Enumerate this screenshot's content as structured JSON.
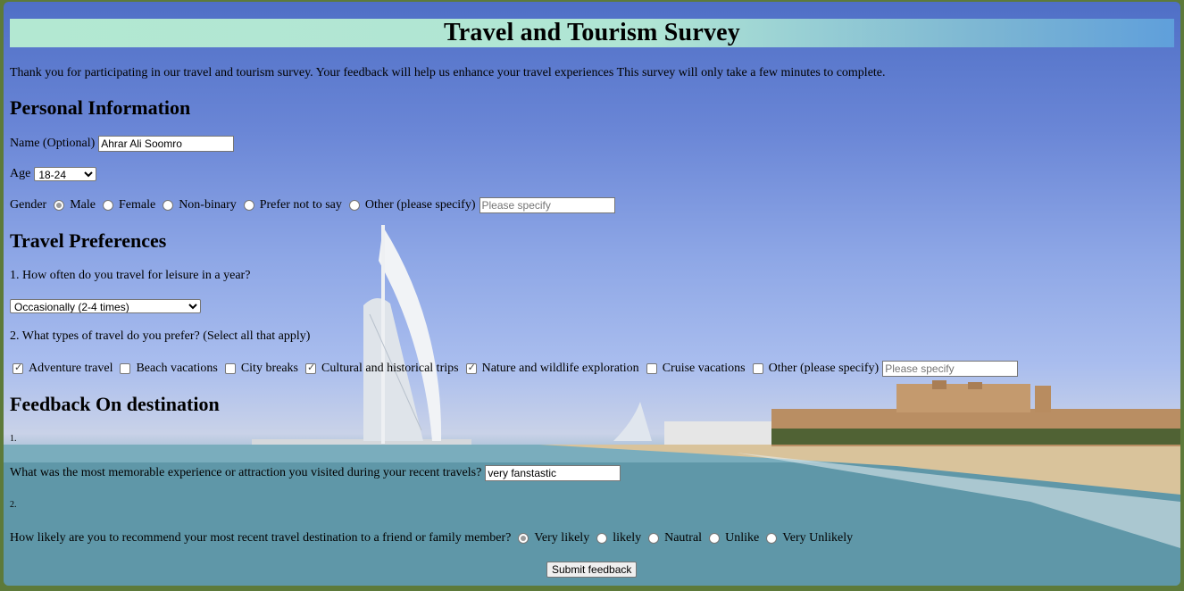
{
  "title": "Travel and Tourism Survey",
  "intro": "Thank you for participating in our travel and tourism survey. Your feedback will help us enhance your travel experiences This survey will only take a few minutes to complete.",
  "personal": {
    "heading": "Personal Information",
    "name_label": "Name (Optional)",
    "name_value": "Ahrar Ali Soomro",
    "age_label": "Age",
    "age_selected": "18-24",
    "gender_label": "Gender",
    "gender_options": [
      "Male",
      "Female",
      "Non-binary",
      "Prefer not to say",
      "Other (please specify)"
    ],
    "gender_selected": "Male",
    "gender_other_placeholder": "Please specify"
  },
  "preferences": {
    "heading": "Travel Preferences",
    "q1": "1. How often do you travel for leisure in a year?",
    "q1_selected": "Occasionally (2-4 times)",
    "q2": "2. What types of travel do you prefer? (Select all that apply)",
    "travel_types": [
      {
        "label": "Adventure travel",
        "checked": true
      },
      {
        "label": "Beach vacations",
        "checked": false
      },
      {
        "label": "City breaks",
        "checked": false
      },
      {
        "label": "Cultural and historical trips",
        "checked": true
      },
      {
        "label": "Nature and wildlife exploration",
        "checked": true
      },
      {
        "label": "Cruise vacations",
        "checked": false
      },
      {
        "label": "Other (please specify)",
        "checked": false
      }
    ],
    "other_placeholder": "Please specify"
  },
  "feedback": {
    "heading": "Feedback On destination",
    "num1": "1.",
    "q1": "What was the most memorable experience or attraction you visited during your recent travels?",
    "q1_value": "very fanstastic",
    "num2": "2.",
    "q2": "How likely are you to recommend your most recent travel destination to a friend or family member?",
    "likely_options": [
      "Very likely",
      "likely",
      "Nautral",
      "Unlike",
      "Very Unlikely"
    ],
    "likely_selected": "Very likely"
  },
  "submit_label": "Submit feedback"
}
